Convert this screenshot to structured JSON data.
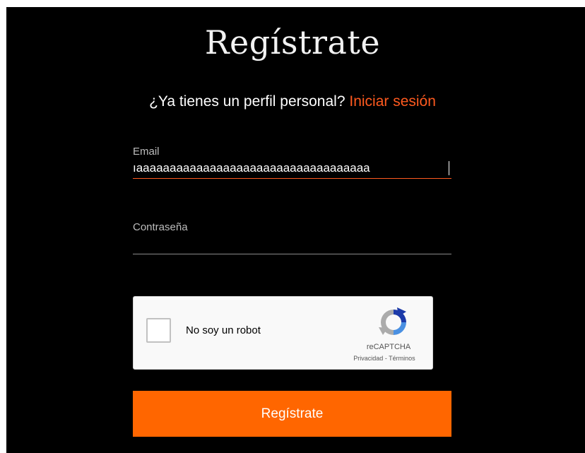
{
  "page": {
    "title": "Regístrate",
    "subtitle_text": "¿Ya tienes un perfil personal?",
    "login_link": "Iniciar sesión"
  },
  "form": {
    "email": {
      "label": "Email",
      "value": "ıaaaaaaaaaaaaaaaaaaaaaaaaaaaaaaaaaaa"
    },
    "password": {
      "label": "Contraseña",
      "value": ""
    },
    "submit_label": "Regístrate"
  },
  "captcha": {
    "label": "No soy un robot",
    "brand": "reCAPTCHA",
    "privacy": "Privacidad",
    "separator": " - ",
    "terms": "Términos",
    "checked": false
  },
  "colors": {
    "background": "#000000",
    "accent": "#ff6600",
    "link": "#ff5a1f"
  }
}
